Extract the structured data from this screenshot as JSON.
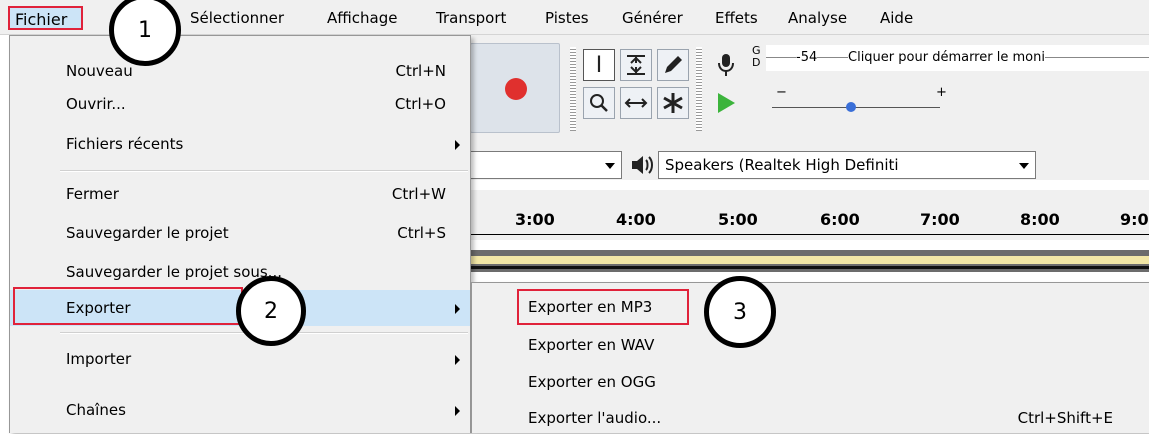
{
  "menubar": {
    "items": [
      "Fichier",
      "Sélectionner",
      "Affichage",
      "Transport",
      "Pistes",
      "Générer",
      "Effets",
      "Analyse",
      "Aide"
    ]
  },
  "file_menu": {
    "items": [
      {
        "label": "Nouveau",
        "shortcut": "Ctrl+N"
      },
      {
        "label": "Ouvrir...",
        "shortcut": "Ctrl+O"
      },
      {
        "label": "Fichiers récents",
        "shortcut": ""
      },
      {
        "label": "Fermer",
        "shortcut": "Ctrl+W"
      },
      {
        "label": "Sauvegarder le projet",
        "shortcut": "Ctrl+S"
      },
      {
        "label": "Sauvegarder le projet sous...",
        "shortcut": ""
      },
      {
        "label": "Exporter",
        "shortcut": ""
      },
      {
        "label": "Importer",
        "shortcut": ""
      },
      {
        "label": "Chaînes",
        "shortcut": ""
      }
    ]
  },
  "export_submenu": {
    "items": [
      {
        "label": "Exporter en MP3",
        "shortcut": ""
      },
      {
        "label": "Exporter en WAV",
        "shortcut": ""
      },
      {
        "label": "Exporter en OGG",
        "shortcut": ""
      },
      {
        "label": "Exporter l'audio...",
        "shortcut": "Ctrl+Shift+E"
      }
    ]
  },
  "meter": {
    "channel_top": "G",
    "channel_bottom": "D",
    "db_value": "-54",
    "monitor_text": "Cliquer pour démarrer le moni"
  },
  "devices": {
    "output": "Speakers (Realtek High Definiti"
  },
  "ruler": {
    "labels": [
      "3:00",
      "4:00",
      "5:00",
      "6:00",
      "7:00",
      "8:00",
      "9:0"
    ]
  },
  "callouts": [
    "1",
    "2",
    "3"
  ],
  "colors": {
    "highlight_border": "#e0223a",
    "record_button": "#e0302e",
    "play_button": "#3cb43c",
    "menu_bg": "#f0f0f0"
  }
}
